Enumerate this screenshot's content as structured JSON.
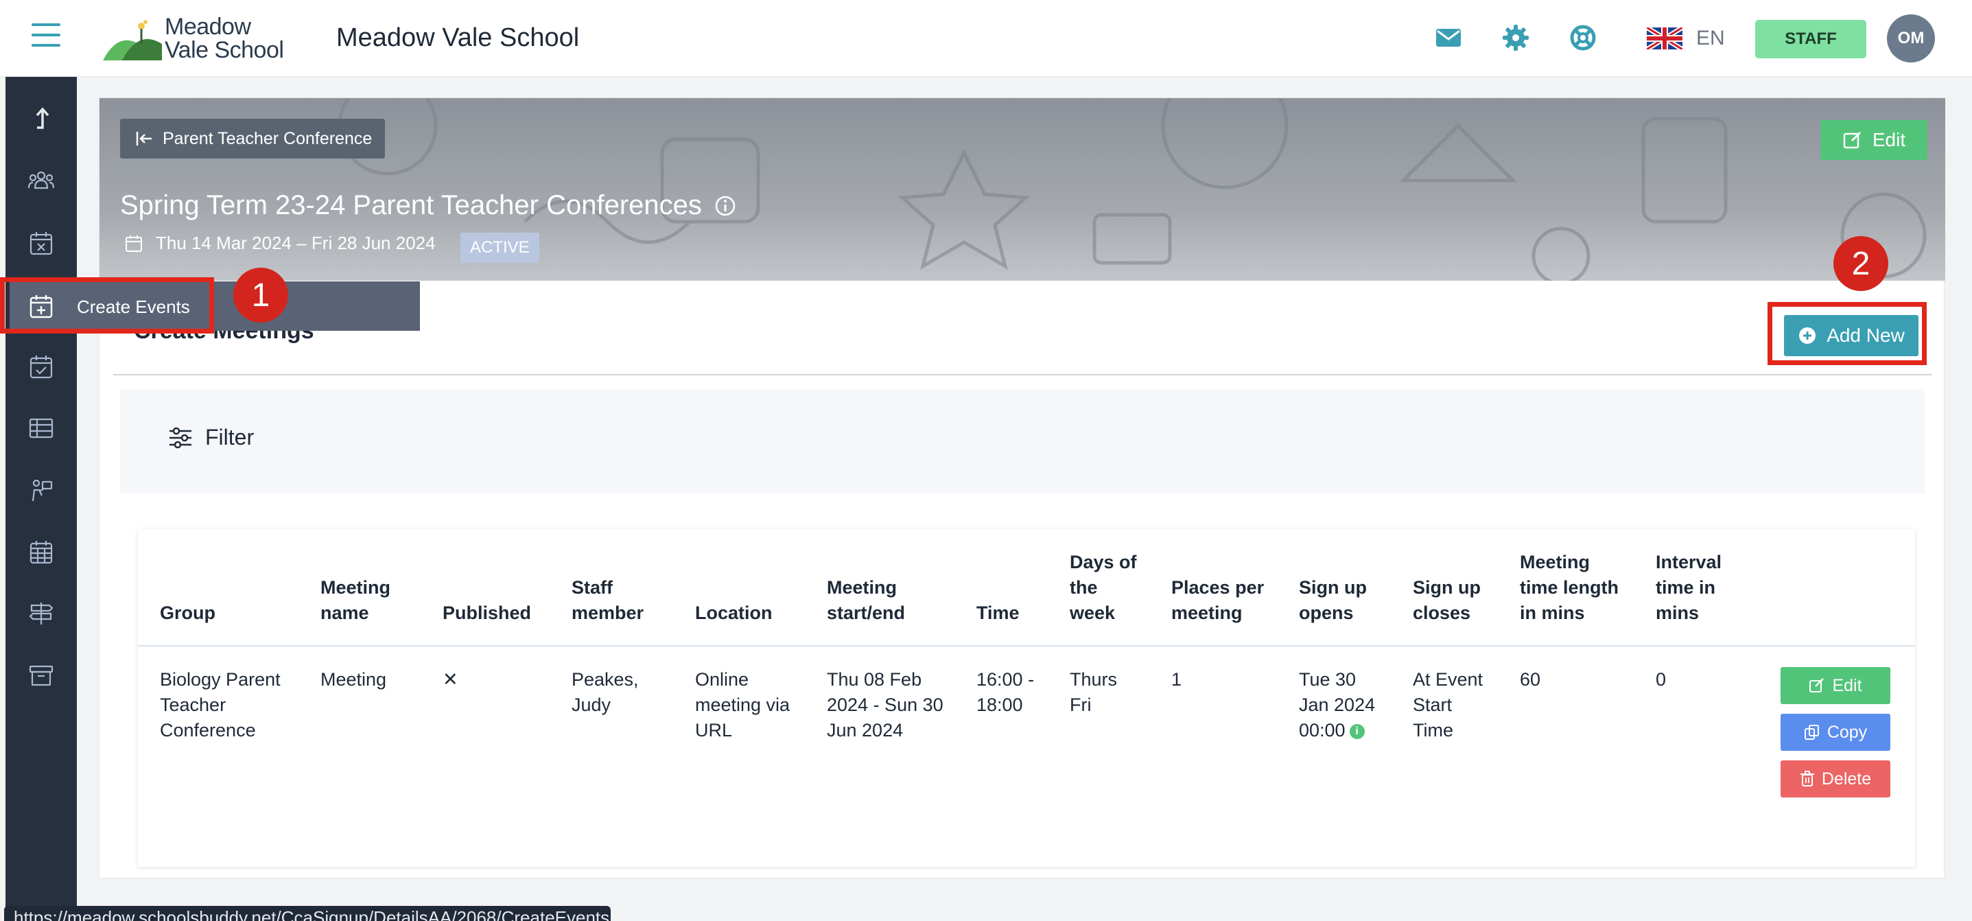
{
  "app": {
    "logo_line1": "Meadow",
    "logo_line2": "Vale School",
    "school_name": "Meadow Vale School",
    "language": "EN",
    "role_badge": "STAFF",
    "avatar_initials": "OM",
    "accent_color": "#3a9fb3"
  },
  "sidebar": {
    "items": [
      {
        "icon": "arrow-up-icon"
      },
      {
        "icon": "people-icon"
      },
      {
        "icon": "calendar-x-icon"
      },
      {
        "icon": "calendar-plus-icon",
        "tooltip": "Create Events"
      },
      {
        "icon": "calendar-check-icon"
      },
      {
        "icon": "table-icon"
      },
      {
        "icon": "person-board-icon"
      },
      {
        "icon": "calendar-grid-icon"
      },
      {
        "icon": "signpost-icon"
      },
      {
        "icon": "archive-icon"
      }
    ]
  },
  "event": {
    "back_label": "Parent Teacher Conference",
    "edit_label": "Edit",
    "title": "Spring Term 23-24 Parent Teacher Conferences",
    "dates": "Thu 14 Mar 2024 – Fri 28 Jun 2024",
    "status": "ACTIVE"
  },
  "meetings": {
    "section_title": "Create Meetings",
    "add_label": "Add New",
    "filter_label": "Filter",
    "columns": {
      "group": "Group",
      "meeting_name": "Meeting name",
      "published": "Published",
      "staff_member": "Staff member",
      "location": "Location",
      "start_end": "Meeting start/end",
      "time": "Time",
      "days": "Days of the week",
      "places": "Places per meeting",
      "sign_up_opens": "Sign up opens",
      "sign_up_closes": "Sign up closes",
      "length": "Meeting time length in mins",
      "interval": "Interval time in mins"
    },
    "rows": [
      {
        "group": "Biology Parent Teacher Conference",
        "meeting_name": "Meeting",
        "published": "✕",
        "staff_member": "Peakes, Judy",
        "location": "Online meeting via URL",
        "start_end": "Thu 08 Feb 2024 - Sun 30 Jun 2024",
        "time": "16:00 - 18:00",
        "days": "Thurs Fri",
        "places": "1",
        "sign_up_opens": "Tue 30 Jan 2024 00:00",
        "sign_up_closes": "At Event Start Time",
        "length": "60",
        "interval": "0",
        "actions": {
          "edit": "Edit",
          "copy": "Copy",
          "delete": "Delete"
        }
      }
    ]
  },
  "annotations": {
    "marker1": "1",
    "marker2": "2"
  },
  "status_url": "https://meadow.schoolsbuddy.net/CcaSignup/DetailsAA/2068/CreateEvents"
}
